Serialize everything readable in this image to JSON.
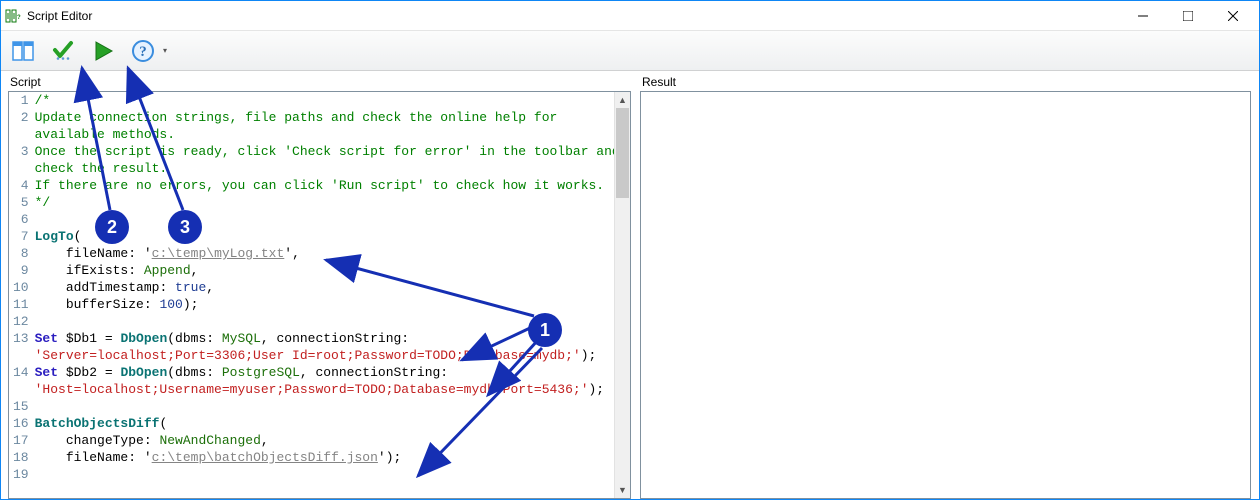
{
  "window": {
    "title": "Script Editor"
  },
  "toolbar": {
    "panels_btn": "Panels",
    "check_btn": "Check script",
    "run_btn": "Run script",
    "help_btn": "Help"
  },
  "panels": {
    "script_label": "Script",
    "result_label": "Result"
  },
  "code": {
    "lines": [
      {
        "n": "1",
        "html": "<span class='tok-comment'>/*</span>"
      },
      {
        "n": "2",
        "html": "<span class='tok-comment'>Update connection strings, file paths and check the online help for available methods.</span>"
      },
      {
        "n": "3",
        "html": "<span class='tok-comment'>Once the script is ready, click 'Check script for error' in the toolbar and check the result.</span>"
      },
      {
        "n": "4",
        "html": "<span class='tok-comment'>If there are no errors, you can click 'Run script' to check how it works.</span>"
      },
      {
        "n": "5",
        "html": "<span class='tok-comment'>*/</span>"
      },
      {
        "n": "6",
        "html": ""
      },
      {
        "n": "7",
        "html": "<span class='tok-func'>LogTo</span>("
      },
      {
        "n": "8",
        "html": "    fileName: '<span class='tok-path'>c:\\temp\\myLog.txt</span>',"
      },
      {
        "n": "9",
        "html": "    ifExists: <span class='tok-ident'>Append</span>,"
      },
      {
        "n": "10",
        "html": "    addTimestamp: <span class='tok-bool'>true</span>,"
      },
      {
        "n": "11",
        "html": "    bufferSize: <span class='tok-num'>100</span>);"
      },
      {
        "n": "12",
        "html": ""
      },
      {
        "n": "13",
        "html": "<span class='tok-kw'>Set</span> $Db1 = <span class='tok-func'>DbOpen</span>(dbms: <span class='tok-ident'>MySQL</span>, connectionString: <span class='tok-str'>'Server=localhost;Port=3306;User Id=root;Password=TODO;Database=mydb;'</span>);"
      },
      {
        "n": "14",
        "html": "<span class='tok-kw'>Set</span> $Db2 = <span class='tok-func'>DbOpen</span>(dbms: <span class='tok-ident'>PostgreSQL</span>, connectionString: <span class='tok-str'>'Host=localhost;Username=myuser;Password=TODO;Database=mydb;Port=5436;'</span>);"
      },
      {
        "n": "15",
        "html": ""
      },
      {
        "n": "16",
        "html": "<span class='tok-func'>BatchObjectsDiff</span>("
      },
      {
        "n": "17",
        "html": "    changeType: <span class='tok-ident'>NewAndChanged</span>,"
      },
      {
        "n": "18",
        "html": "    fileName: '<span class='tok-path'>c:\\temp\\batchObjectsDiff.json</span>');"
      },
      {
        "n": "19",
        "html": ""
      }
    ]
  },
  "annotations": {
    "b1": "1",
    "b2": "2",
    "b3": "3"
  }
}
